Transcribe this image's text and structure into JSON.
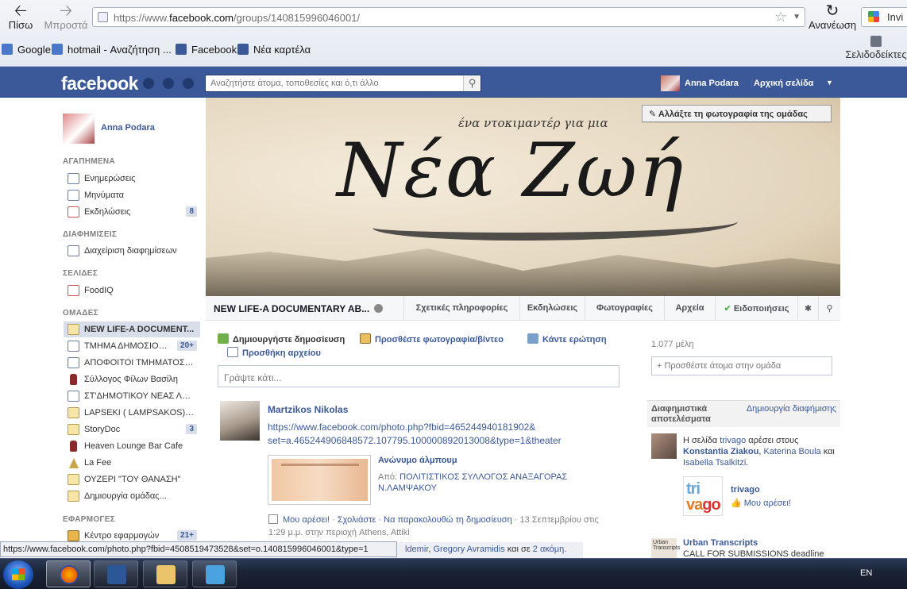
{
  "browser": {
    "back_label": "Πίσω",
    "forward_label": "Μπροστά",
    "url_prefix": "https://www.",
    "url_domain": "facebook.com",
    "url_path": "/groups/140815996046001/",
    "reload_label": "Ανανέωση",
    "search_engine_label": "Invi",
    "bookmarks": [
      "Google",
      "hotmail - Αναζήτηση ...",
      "Facebook",
      "Νέα καρτέλα"
    ],
    "bookmarks_menu_label": "Σελιδοδείκτες"
  },
  "fb": {
    "logo": "facebook",
    "search_placeholder": "Αναζητήστε άτομα, τοποθεσίες και ό,τι άλλο",
    "user_name": "Anna Podara",
    "home_label": "Αρχική σελίδα"
  },
  "sidebar": {
    "profile_name": "Anna Podara",
    "favorites_header": "ΑΓΑΠΗΜΕΝΑ",
    "favorites": [
      {
        "label": "Ενημερώσεις",
        "count": ""
      },
      {
        "label": "Μηνύματα",
        "count": ""
      },
      {
        "label": "Εκδηλώσεις",
        "count": "8"
      }
    ],
    "ads_header": "ΔΙΑΦΗΜΙΣΕΙΣ",
    "ads_items": [
      {
        "label": "Διαχείριση διαφημίσεων"
      }
    ],
    "pages_header": "ΣΕΛΙΔΕΣ",
    "pages_items": [
      {
        "label": "FoodIQ"
      }
    ],
    "groups_header": "ΟΜΑΔΕΣ",
    "groups": [
      {
        "label": "NEW LIFE-A DOCUMENT...",
        "count": ""
      },
      {
        "label": "ΤΜΗΜΑ ΔΗΜΟΣΙΟΓΡ...",
        "count": "20+"
      },
      {
        "label": "ΑΠΟΦΟΙΤΟΙ ΤΜΗΜΑΤΟΣ Δ...",
        "count": ""
      },
      {
        "label": "Σύλλογος Φίλων Βασίλη",
        "count": ""
      },
      {
        "label": "ΣΤ'ΔΗΜΟΤΙΚΟΥ ΝΕΑΣ ΛΑΜ...",
        "count": ""
      },
      {
        "label": "LAPSEKI ( LAMPSAKOS) HE...",
        "count": ""
      },
      {
        "label": "StoryDoc",
        "count": "3"
      },
      {
        "label": "Heaven Lounge Bar Cafe",
        "count": ""
      },
      {
        "label": "La Fee",
        "count": ""
      },
      {
        "label": "ΟΥΖΕΡΙ \"ΤΟΥ ΘΑΝΑΣΗ\"",
        "count": ""
      },
      {
        "label": "Δημιουργία ομάδας...",
        "count": ""
      }
    ],
    "apps_header": "ΕΦΑΡΜΟΓΕΣ",
    "apps": [
      {
        "label": "Κέντρο εφαρμογών",
        "count": "21+"
      }
    ]
  },
  "cover": {
    "subtitle": "ένα ντοκιμαντέρ για μια",
    "title": "Νέα Ζωή",
    "change_cover_label": "Αλλάξτε τη φωτογραφία της ομάδας"
  },
  "group_tabs": {
    "group_name": "NEW LIFE-A DOCUMENTARY AB...",
    "about": "Σχετικές πληροφορίες",
    "events": "Εκδηλώσεις",
    "photos": "Φωτογραφίες",
    "files": "Αρχεία",
    "notifications": "Ειδοποιήσεις"
  },
  "composer": {
    "create_post": "Δημιουργήστε δημοσίευση",
    "add_photo": "Προσθέστε φωτογραφία/βίντεο",
    "ask_question": "Κάντε ερώτηση",
    "add_file": "Προσθήκη αρχείου",
    "placeholder": "Γράψτε κάτι..."
  },
  "post": {
    "author": "Martzikos Nikolas",
    "link_line1": "https://www.facebook.com/photo.php?fbid=465244940181902&",
    "link_line2": "set=a.465244906848572.107795.100000892013008&type=1&theater",
    "attachment_title": "Ανώνυμο άλμπουμ",
    "attachment_from_prefix": "Από: ",
    "attachment_from": "ΠΟΛΙΤΙΣΤΙΚΟΣ ΣΥΛΛΟΓΟΣ ΑΝΑΞΑΓΟΡΑΣ Ν.ΛΑΜΨΑΚΟΥ",
    "like": "Μου αρέσει!",
    "comment": "Σχολιάστε",
    "unfollow": "Να παρακολουθώ τη δημοσίευση",
    "meta_time": "13 Σεπτεμβρίου στις 1:29 μ.μ. στην περιοχή Athens, Attiki",
    "likes_name1": "ldemir",
    "likes_name2": "Gregory Avramidis",
    "likes_suffix": " και σε ",
    "likes_more": "2 ακόμη."
  },
  "right": {
    "members": "1.077 μέλη",
    "add_people": "+ Προσθέστε άτομα στην ομάδα",
    "ads_title": "Διαφημιστικά αποτελέσματα",
    "create_ad": "Δημιουργία διαφήμισης",
    "ad1_prefix": "Η σελίδα ",
    "ad1_page": "trivago",
    "ad1_mid": " αρέσει στους ",
    "ad1_p1": "Konstantia Ziakou",
    "ad1_p2": "Katerina Boula",
    "ad1_and": " και ",
    "ad1_p3": "Isabella Tsalkitzi",
    "trivago_logo_a": "tri",
    "trivago_logo_b": "va",
    "trivago_logo_c": "go",
    "trivago_name": "trivago",
    "trivago_like": "Μου αρέσει!",
    "ut_thumb": "Urban Transcripts",
    "ut_name": "Urban Transcripts",
    "ut_text": "CALL FOR SUBMISSIONS deadline"
  },
  "status_url": "https://www.facebook.com/photo.php?fbid=4508519473528&set=o.140815996046001&type=1",
  "taskbar": {
    "lang": "EN"
  }
}
